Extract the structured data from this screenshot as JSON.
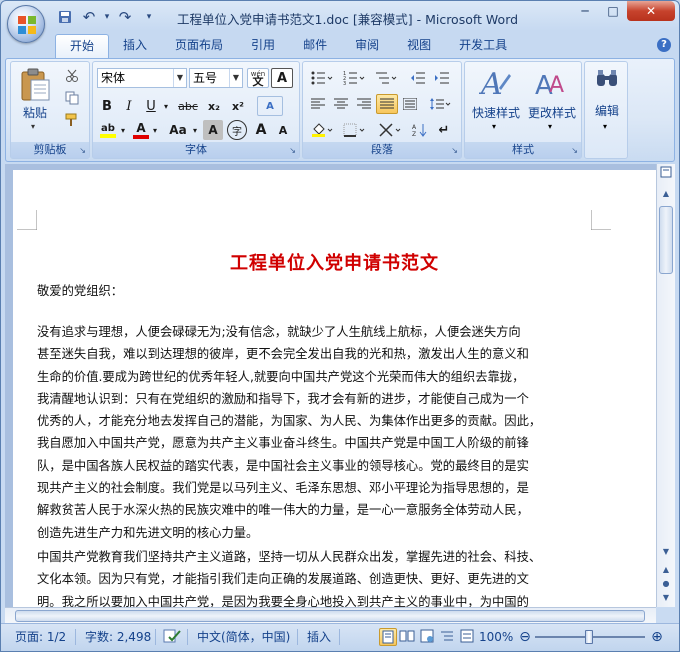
{
  "window": {
    "title": "工程单位入党申请书范文1.doc [兼容模式] - Microsoft Word",
    "controls": {
      "minimize": "─",
      "maximize": "□",
      "close": "✕"
    }
  },
  "qat": {
    "save": "save-icon",
    "undo": "↶",
    "undo_dd": "▾",
    "redo": "↷",
    "customize": "▾"
  },
  "tabs": [
    "开始",
    "插入",
    "页面布局",
    "引用",
    "邮件",
    "审阅",
    "视图",
    "开发工具"
  ],
  "ribbon": {
    "clipboard": {
      "label": "剪贴板",
      "paste": "粘贴"
    },
    "font": {
      "label": "字体",
      "font_name": "宋体",
      "font_size": "五号",
      "bold": "B",
      "italic": "I",
      "underline": "U",
      "strike": "abc",
      "subscript": "x₂",
      "superscript": "x²",
      "highlight": "ab",
      "font_color": "A",
      "change_case": "Aa",
      "char_shading": "A",
      "enclose": "字",
      "grow": "A",
      "shrink": "A",
      "phonetic": "wén",
      "border": "A",
      "clear": "A"
    },
    "paragraph": {
      "label": "段落"
    },
    "styles": {
      "label": "样式",
      "quick_styles": "快速样式",
      "change_styles": "更改样式"
    },
    "editing": {
      "label": "编辑"
    }
  },
  "document": {
    "title": "工程单位入党申请书范文",
    "salutation": "敬爱的党组织：",
    "para1": [
      "没有追求与理想，人便会碌碌无为;没有信念，就缺少了人生航线上航标，人便会迷失方向",
      "甚至迷失自我，难以到达理想的彼岸，更不会完全发出自我的光和热，激发出人生的意义和",
      "生命的价值.要成为跨世纪的优秀年轻人,就要向中国共产党这个光荣而伟大的组织去靠拢，",
      "我清醒地认识到：只有在党组织的激励和指导下，我才会有新的进步，才能使自己成为一个",
      "优秀的人，才能充分地去发挥自己的潜能，为国家、为人民、为集体作出更多的贡献。因此，",
      "我自愿加入中国共产党，愿意为共产主义事业奋斗终生。中国共产党是中国工人阶级的前锋",
      "队，是中国各族人民权益的踏实代表，是中国社会主义事业的领导核心。党的最终目的是实",
      "现共产主义的社会制度。我们党是以马列主义、毛泽东思想、邓小平理论为指导思想的，是",
      "解救贫苦人民于水深火热的民族灾难中的唯一伟大的力量，是一心一意服务全体劳动人民，",
      "创造先进生产力和先进文明的核心力量。"
    ],
    "para2": [
      "中国共产党教育我们坚持共产主义道路，坚持一切从人民群众出发，掌握先进的社会、科技、",
      "文化本领。因为只有党，才能指引我们走向正确的发展道路、创造更快、更好、更先进的文",
      "明。我之所以要加入中国共产党，是因为我要全身心地投入到共产主义的事业中，为中国的"
    ]
  },
  "statusbar": {
    "page": "页面: 1/2",
    "words": "字数: 2,498",
    "language": "中文(简体，中国)",
    "mode": "插入",
    "zoom": "100%",
    "zoom_level": 1.0
  },
  "colors": {
    "title_red": "#d00000",
    "accent": "#15428b",
    "ribbon_bg": "#dbe7f6"
  }
}
